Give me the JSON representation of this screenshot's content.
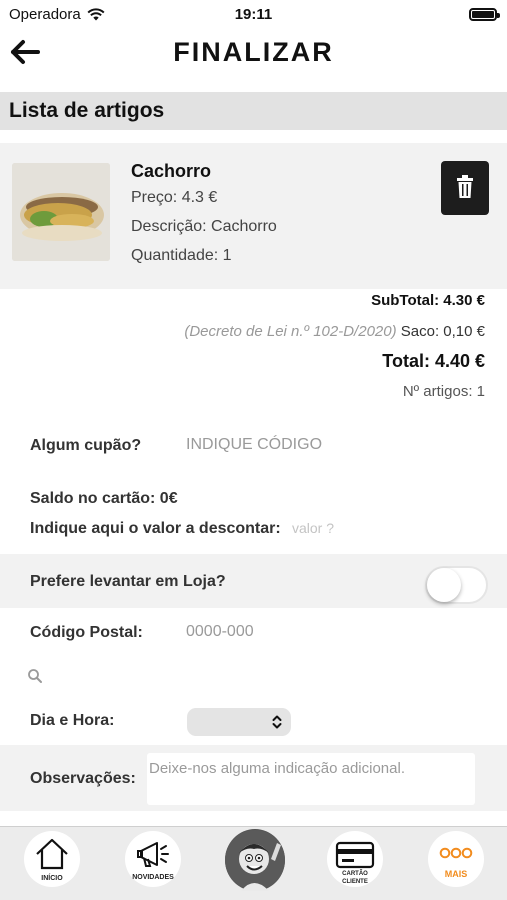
{
  "status_bar": {
    "carrier": "Operadora",
    "time": "19:11"
  },
  "header": {
    "title": "FINALIZAR"
  },
  "section": {
    "title": "Lista de artigos"
  },
  "cart": {
    "items": [
      {
        "name": "Cachorro",
        "price": "Preço: 4.3 €",
        "description": "Descrição: Cachorro",
        "quantity": "Quantidade: 1"
      }
    ]
  },
  "totals": {
    "subtotal": "SubTotal: 4.30 €",
    "decree": "(Decreto de Lei n.º 102-D/2020)",
    "bag": "Saco: 0,10 €",
    "total": "Total: 4.40 €",
    "count": "Nº artigos: 1"
  },
  "form": {
    "coupon_label": "Algum cupão?",
    "coupon_placeholder": "INDIQUE CÓDIGO",
    "balance_label": "Saldo no cartão: 0€",
    "discount_label": "Indique aqui o valor a descontar:",
    "discount_placeholder": "valor ?",
    "pickup_label": "Prefere levantar em Loja?",
    "pickup_enabled": false,
    "postal_label": "Código Postal:",
    "postal_placeholder": "0000-000",
    "datetime_label": "Dia e Hora:",
    "notes_label": "Observações:",
    "notes_placeholder": "Deixe-nos alguma indicação adicional."
  },
  "tabbar": {
    "tabs": [
      {
        "label": "INÍCIO",
        "icon": "home-icon"
      },
      {
        "label": "NOVIDADES",
        "icon": "megaphone-icon"
      },
      {
        "label": "",
        "icon": "mascot-icon"
      },
      {
        "label_line1": "CARTÃO",
        "label_line2": "CLIENTE",
        "icon": "card-icon"
      },
      {
        "label": "MAIS",
        "icon": "more-icon"
      }
    ],
    "accent": "#f28c1e"
  }
}
